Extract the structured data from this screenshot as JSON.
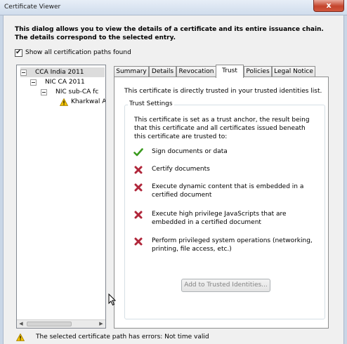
{
  "window": {
    "title": "Certificate Viewer",
    "close_label": "x"
  },
  "description": "This dialog allows you to view the details of a certificate and its entire issuance chain. The details correspond to the selected entry.",
  "show_all": {
    "label": "Show all certification paths found",
    "checked": true
  },
  "tree": {
    "items": [
      {
        "label": "CCA India 2011"
      },
      {
        "label": "NIC CA 2011"
      },
      {
        "label": "NIC sub-CA fc"
      },
      {
        "label": "Kharkwal A"
      }
    ]
  },
  "tabs": [
    {
      "label": "Summary"
    },
    {
      "label": "Details"
    },
    {
      "label": "Revocation"
    },
    {
      "label": "Trust"
    },
    {
      "label": "Policies"
    },
    {
      "label": "Legal Notice"
    }
  ],
  "active_tab": "Trust",
  "trust": {
    "directly_trusted": "This certificate is directly trusted in your trusted identities list.",
    "group_title": "Trust Settings",
    "settings_text": "This certificate is set as a trust anchor, the result being that this certificate and all certificates issued beneath this certificate are trusted to:",
    "permissions": [
      {
        "label": "Sign documents or data",
        "icon": "check-icon",
        "allowed": true
      },
      {
        "label": "Certify documents",
        "icon": "cross-icon",
        "allowed": false
      },
      {
        "label": "Execute dynamic content that is embedded in a certified document",
        "icon": "cross-icon",
        "allowed": false
      },
      {
        "label": "Execute high privilege JavaScripts that are embedded in a certified document",
        "icon": "cross-icon",
        "allowed": false
      },
      {
        "label": "Perform privileged system operations (networking, printing, file access, etc.)",
        "icon": "cross-icon",
        "allowed": false
      }
    ],
    "add_button": "Add to Trusted Identities..."
  },
  "status": {
    "text": "The selected certificate path has errors: Not time valid",
    "icon": "warning-icon"
  },
  "colors": {
    "check": "#3a9a1e",
    "cross": "#b0263a",
    "warning": "#f2c200"
  }
}
